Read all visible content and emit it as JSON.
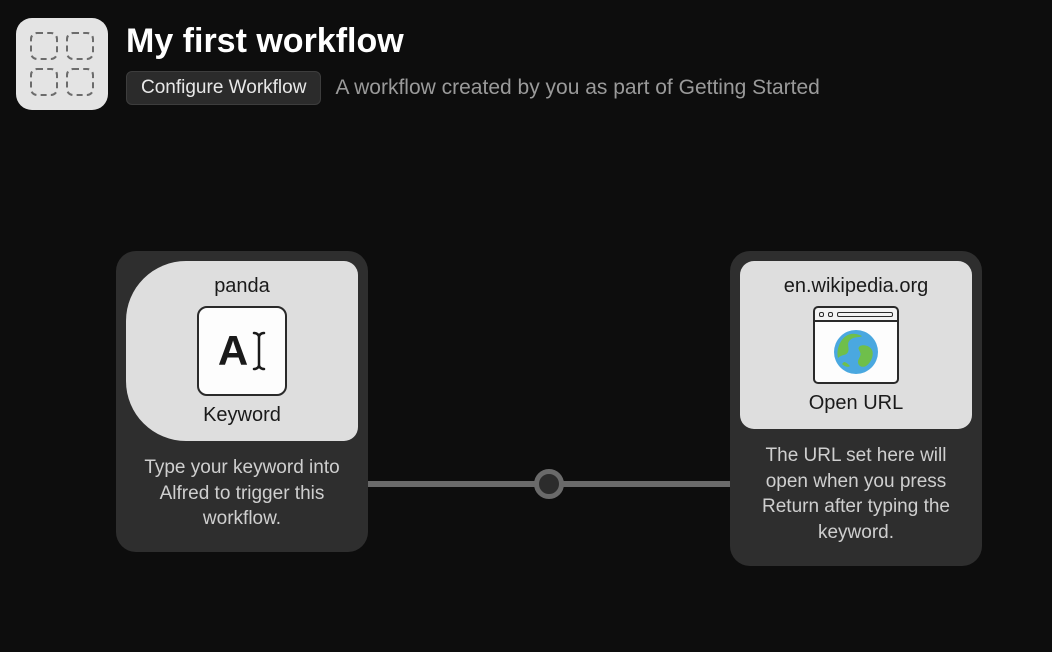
{
  "header": {
    "title": "My first workflow",
    "configure_label": "Configure Workflow",
    "description": "A workflow created by you as part of Getting Started"
  },
  "nodes": {
    "keyword": {
      "value": "panda",
      "type_label": "Keyword",
      "help": "Type your keyword into Alfred to trigger this workflow.",
      "icon": "text-cursor-icon"
    },
    "open_url": {
      "value": "en.wikipedia.org",
      "type_label": "Open URL",
      "help": "The URL set here will open when you press Return after typing the keyword.",
      "icon": "browser-globe-icon"
    }
  }
}
